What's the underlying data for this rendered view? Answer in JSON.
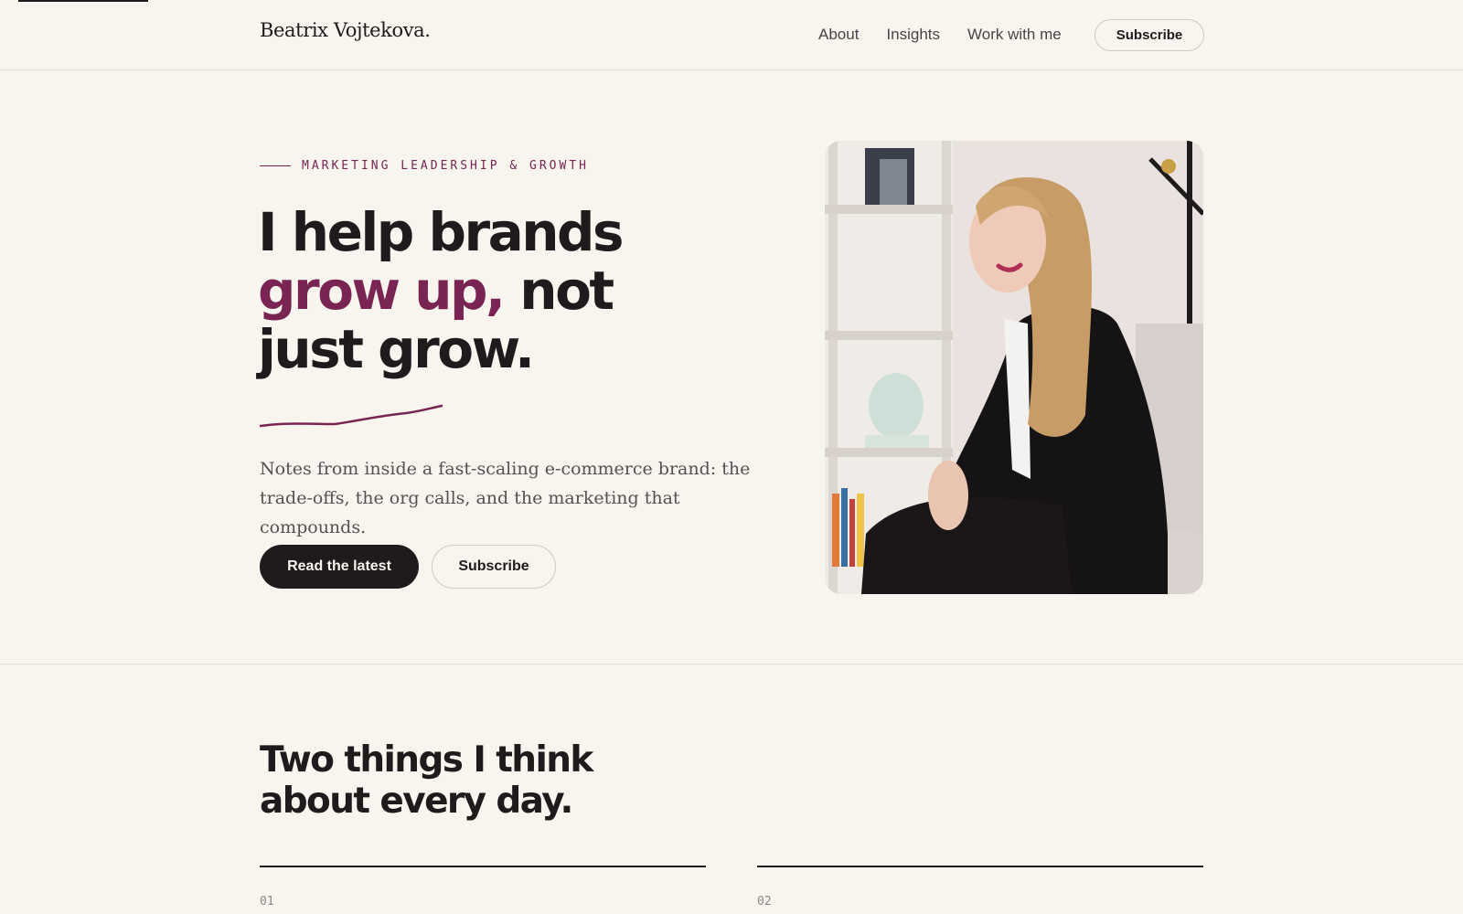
{
  "header": {
    "brand": "Beatrix Vojtekova.",
    "nav": [
      {
        "label": "About"
      },
      {
        "label": "Insights"
      },
      {
        "label": "Work with me"
      }
    ],
    "subscribe_label": "Subscribe"
  },
  "hero": {
    "eyebrow": "MARKETING LEADERSHIP & GROWTH",
    "headline_line1": "I help brands",
    "headline_accent": "grow up,",
    "headline_line2_rest": " not",
    "headline_line3": "just grow.",
    "lede": "Notes from inside a fast-scaling e-commerce brand: the trade-offs, the org calls, and the marketing that compounds.",
    "primary_cta": "Read the latest",
    "secondary_cta": "Subscribe",
    "portrait_icon": "portrait-photo"
  },
  "section": {
    "title": "Two things I think about every day.",
    "columns": [
      {
        "number": "01"
      },
      {
        "number": "02"
      }
    ]
  },
  "colors": {
    "background": "#f8f5ef",
    "text": "#1f1a1c",
    "accent": "#7a2454",
    "muted": "#555052"
  }
}
